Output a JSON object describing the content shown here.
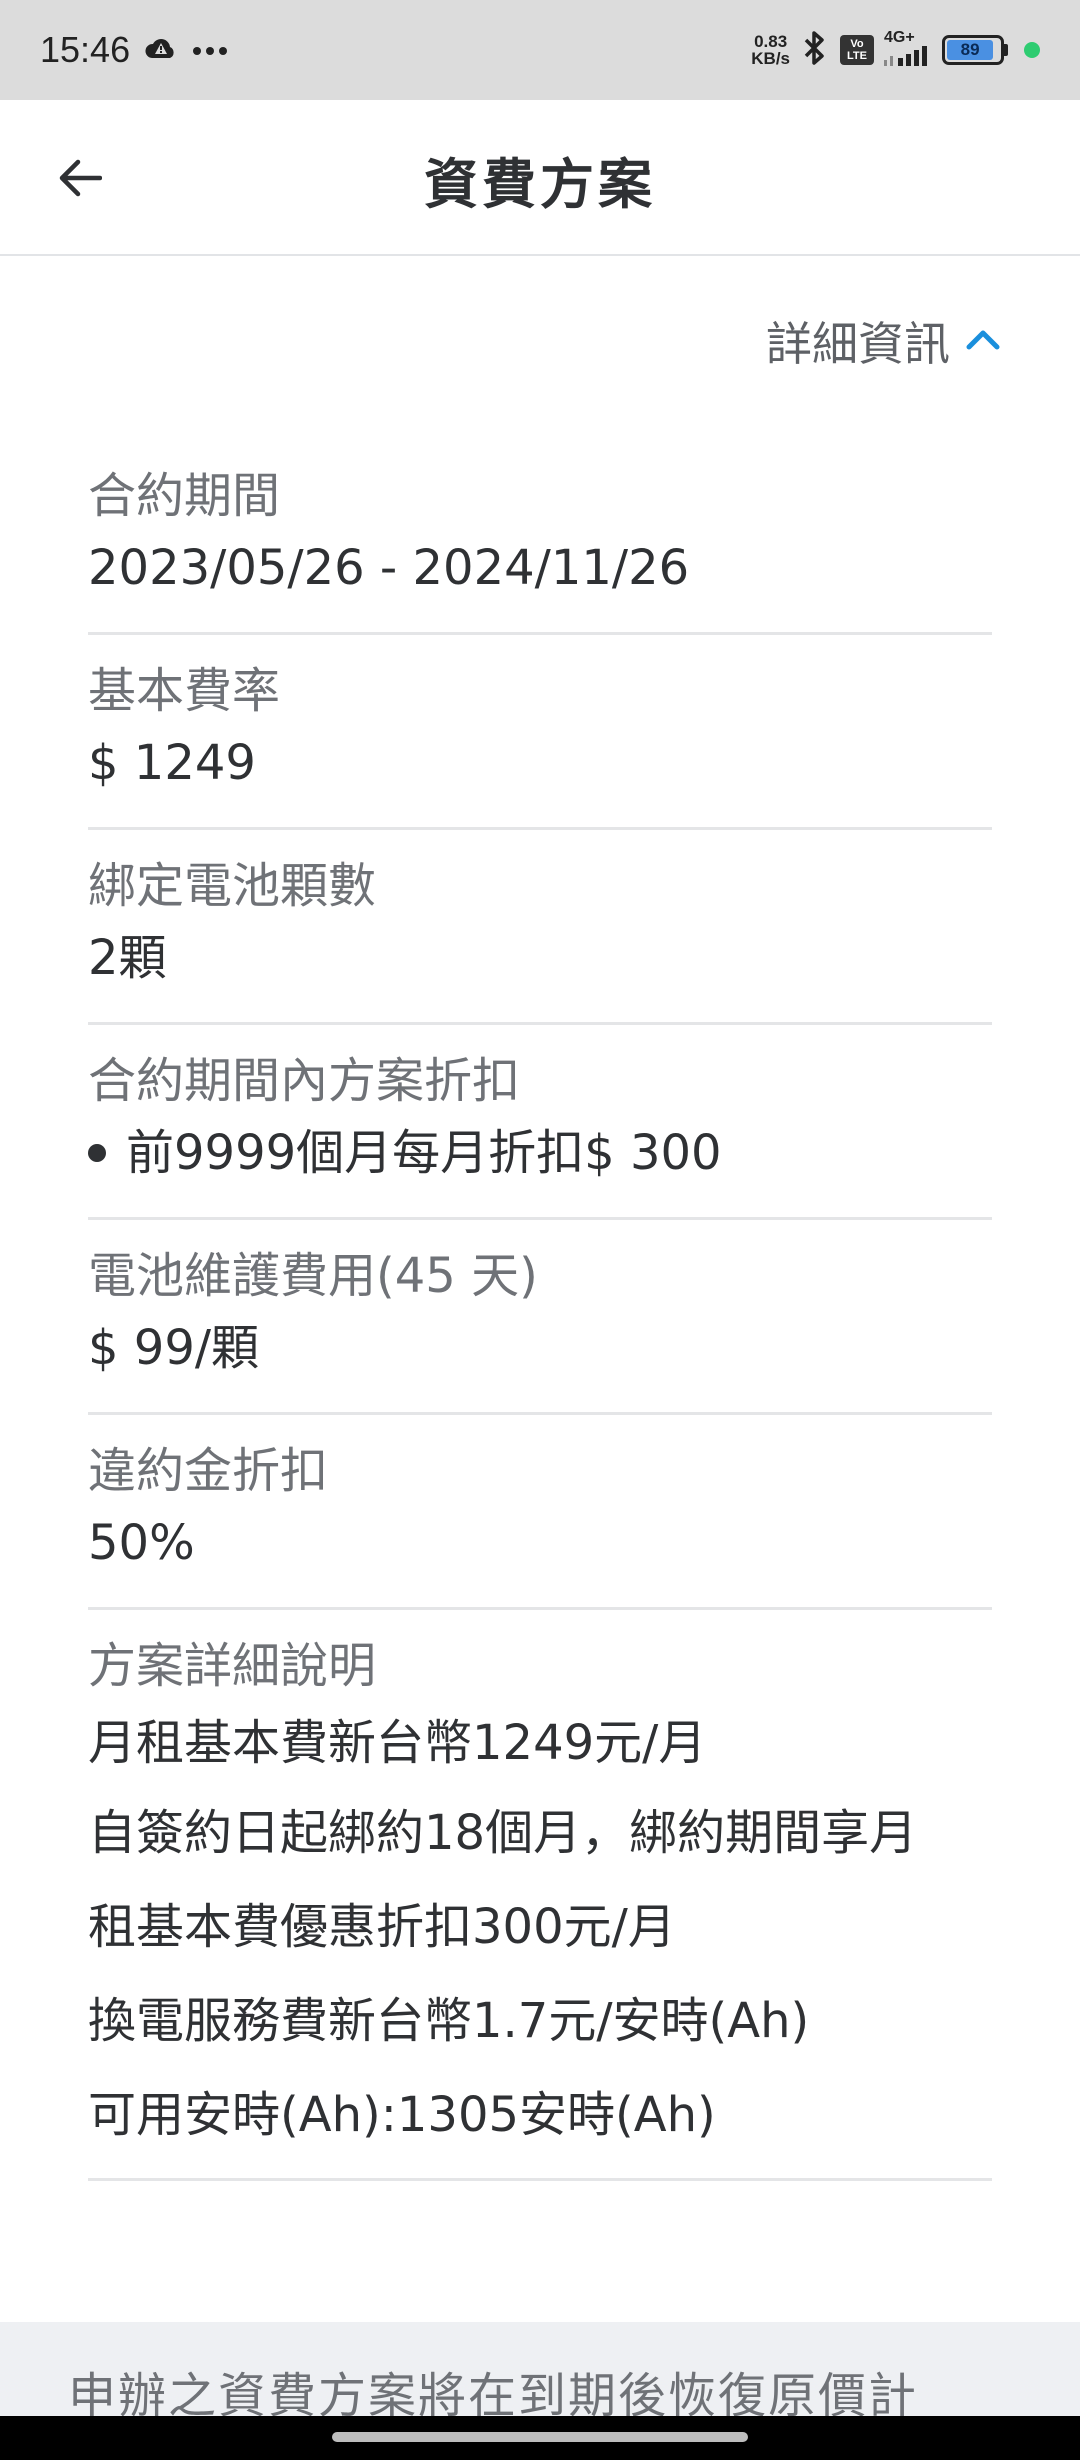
{
  "status": {
    "time": "15:46",
    "net_speed_value": "0.83",
    "net_speed_unit": "KB/s",
    "volte_top": "Vo",
    "volte_bottom": "LTE",
    "network": "4G+",
    "battery": "89",
    "battery_level": 0.89,
    "icons": [
      "cloud-warning-icon",
      "more-dots-icon",
      "bluetooth-icon",
      "signal-icon"
    ]
  },
  "header": {
    "title": "資費方案"
  },
  "details_toggle": {
    "label": "詳細資訊",
    "accent": "#1a8fdc"
  },
  "items": [
    {
      "label": "合約期間",
      "value": "2023/05/26 - 2024/11/26"
    },
    {
      "label": "基本費率",
      "value": "$ 1249"
    },
    {
      "label": "綁定電池顆數",
      "value": "2顆"
    },
    {
      "label": "合約期間內方案折扣",
      "value": "前9999個月每月折扣$ 300"
    },
    {
      "label": "電池維護費用(45 天)",
      "value": "$ 99/顆"
    },
    {
      "label": "違約金折扣",
      "value": "50%"
    }
  ],
  "description": {
    "label": "方案詳細說明",
    "lines": [
      "月租基本費新台幣1249元/月",
      "自簽約日起綁約18個月，綁約期間享月",
      "租基本費優惠折扣300元/月",
      "換電服務費新台幣1.7元/安時(Ah)",
      "可用安時(Ah):1305安時(Ah)"
    ]
  },
  "footer": {
    "note": "申辦之資費方案將在到期後恢復原價計"
  }
}
